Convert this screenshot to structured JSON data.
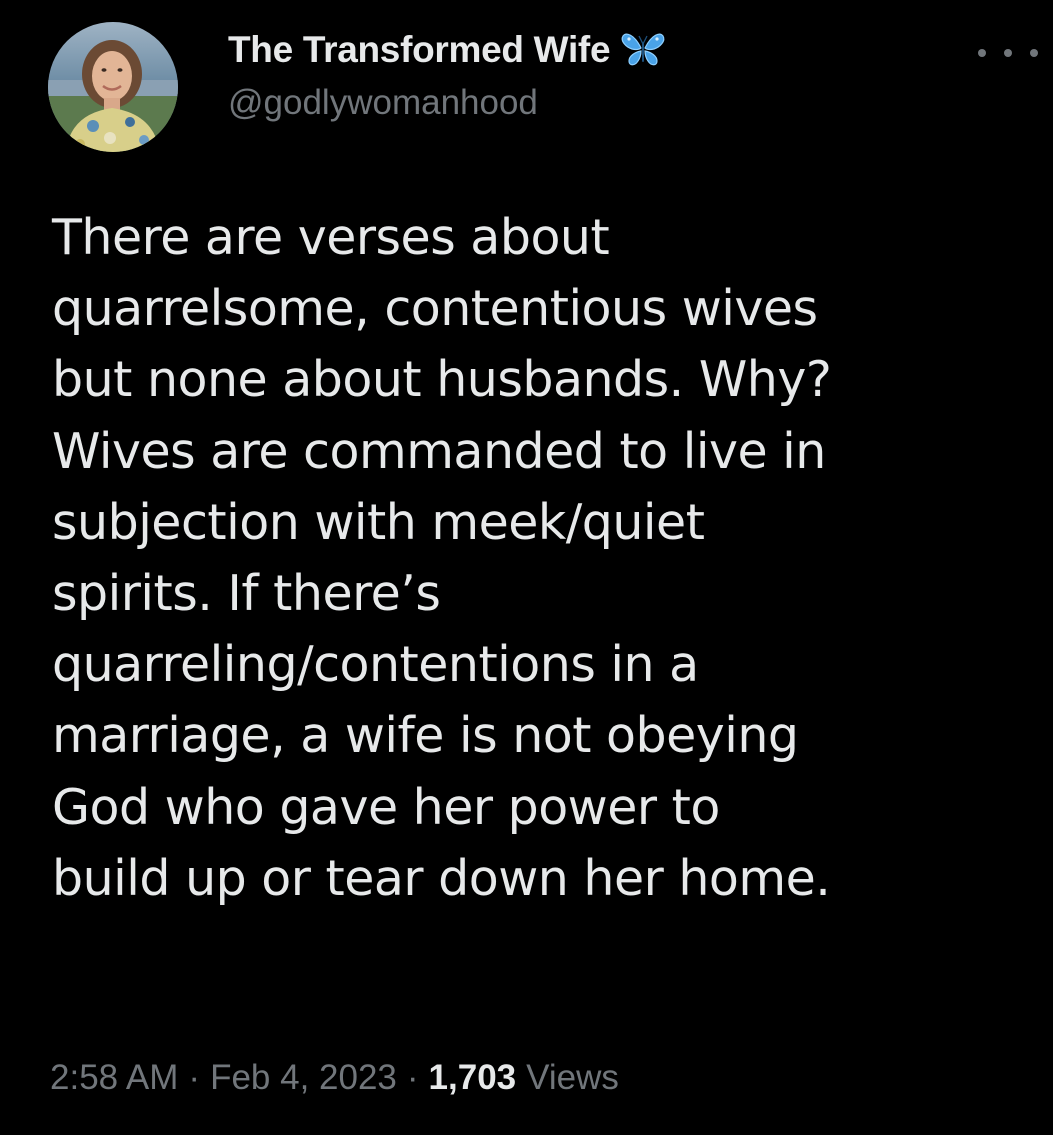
{
  "author": {
    "display_name": "The Transformed Wife",
    "handle": "@godlywomanhood",
    "badge_icon": "butterfly-icon",
    "avatar_icon": "profile-photo"
  },
  "menu": {
    "icon": "more-options-icon"
  },
  "tweet": {
    "lines": [
      "There are verses about",
      "quarrelsome, contentious wives",
      "but none about husbands. Why?",
      "Wives are commanded to live in",
      "subjection with meek/quiet",
      "spirits. If there’s",
      "quarreling/contentions in a",
      "marriage, a wife is not obeying",
      "God who gave her power to",
      "build up or tear down her home."
    ]
  },
  "meta": {
    "time": "2:58 AM",
    "separator": "·",
    "date": "Feb 4, 2023",
    "views_count": "1,703",
    "views_label": "Views"
  },
  "colors": {
    "background": "#000000",
    "primary_text": "#e7e9ea",
    "secondary_text": "#71767b",
    "badge_blue": "#4aa3e8"
  }
}
